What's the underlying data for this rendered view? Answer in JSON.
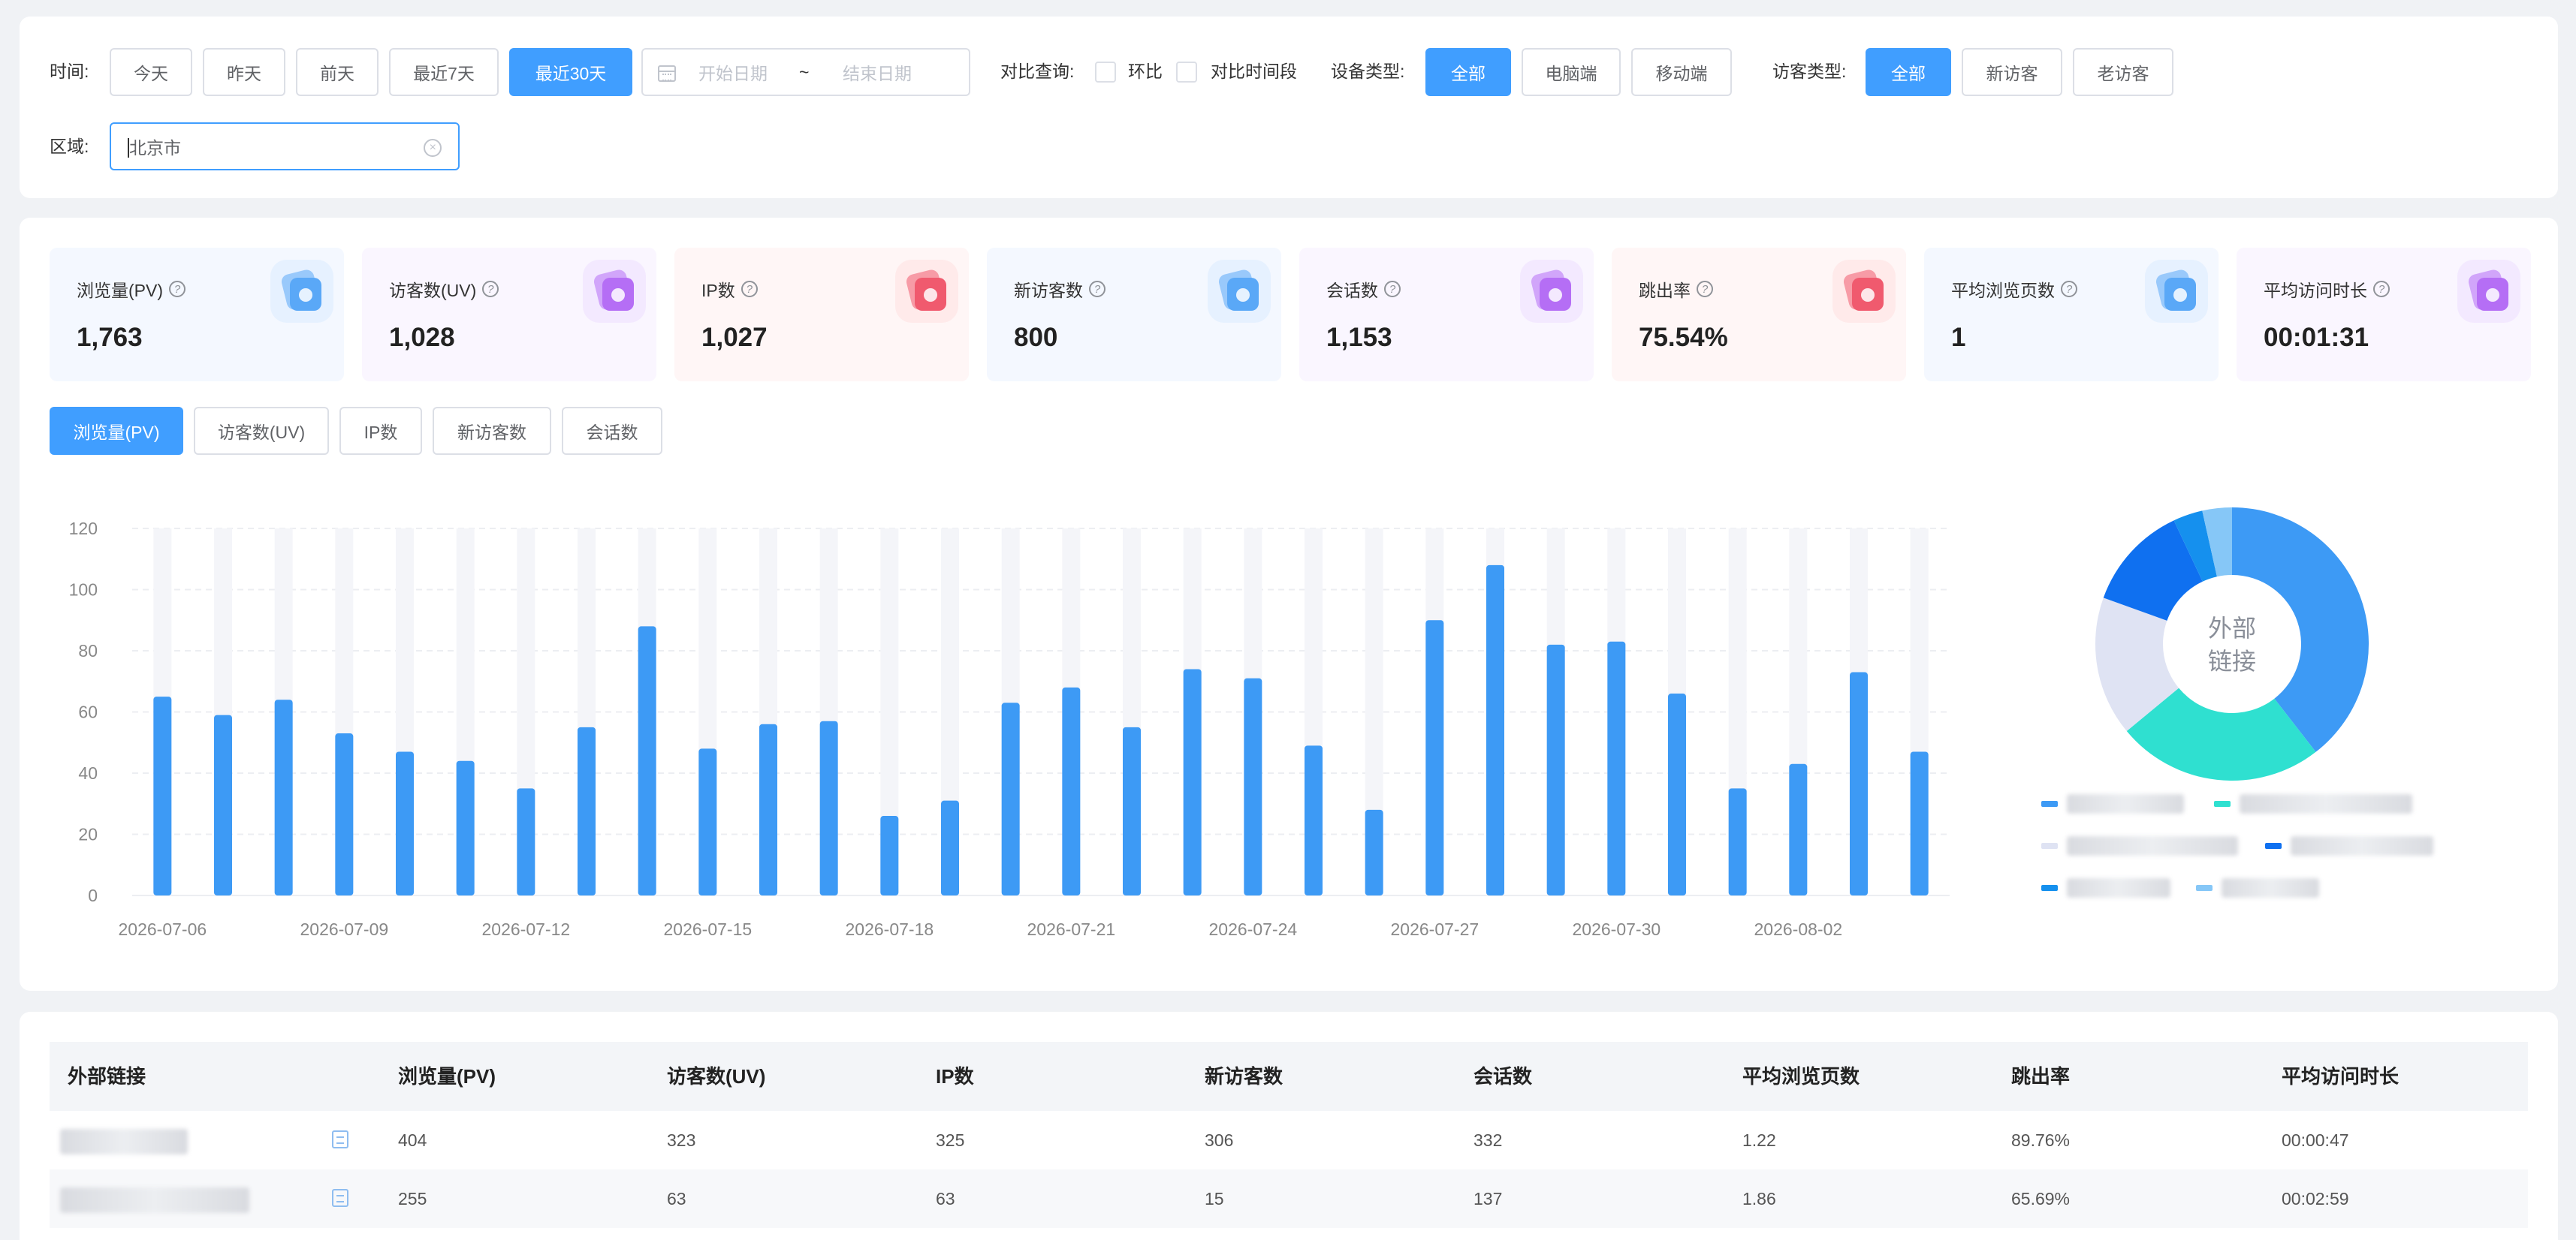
{
  "filters": {
    "time_label": "时间:",
    "time_buttons": [
      "今天",
      "昨天",
      "前天",
      "最近7天",
      "最近30天"
    ],
    "date_start_placeholder": "开始日期",
    "date_sep": "~",
    "date_end_placeholder": "结束日期",
    "compare_label": "对比查询:",
    "compare_options": [
      "环比",
      "对比时间段"
    ],
    "device_label": "设备类型:",
    "device_buttons": [
      "全部",
      "电脑端",
      "移动端"
    ],
    "visitor_label": "访客类型:",
    "visitor_buttons": [
      "全部",
      "新访客",
      "老访客"
    ],
    "region_label": "区域:",
    "region_value": "北京市"
  },
  "kpis": [
    {
      "name": "浏览量(PV)",
      "value": "1,763",
      "icon": "pv-icon",
      "bg": "#f4f8ff",
      "color": "#5aa8f7"
    },
    {
      "name": "访客数(UV)",
      "value": "1,028",
      "icon": "uv-icon",
      "bg": "#faf6ff",
      "color": "#b56ef5"
    },
    {
      "name": "IP数",
      "value": "1,027",
      "icon": "ip-icon",
      "bg": "#fff6f6",
      "color": "#f05a6e"
    },
    {
      "name": "新访客数",
      "value": "800",
      "icon": "new-visitor-icon",
      "bg": "#f4f8ff",
      "color": "#5aa8f7"
    },
    {
      "name": "会话数",
      "value": "1,153",
      "icon": "session-icon",
      "bg": "#faf6ff",
      "color": "#b56ef5"
    },
    {
      "name": "跳出率",
      "value": "75.54%",
      "icon": "bounce-icon",
      "bg": "#fff6f6",
      "color": "#f05a6e"
    },
    {
      "name": "平均浏览页数",
      "value": "1",
      "icon": "avg-pages-icon",
      "bg": "#f4f8ff",
      "color": "#5aa8f7"
    },
    {
      "name": "平均访问时长",
      "value": "00:01:31",
      "icon": "avg-duration-icon",
      "bg": "#faf6ff",
      "color": "#b56ef5"
    }
  ],
  "metric_tabs": [
    "浏览量(PV)",
    "访客数(UV)",
    "IP数",
    "新访客数",
    "会话数"
  ],
  "chart_data": [
    {
      "type": "bar",
      "categories": [
        "2026-07-06",
        "2026-07-07",
        "2026-07-08",
        "2026-07-09",
        "2026-07-10",
        "2026-07-11",
        "2026-07-12",
        "2026-07-13",
        "2026-07-14",
        "2026-07-15",
        "2026-07-16",
        "2026-07-17",
        "2026-07-18",
        "2026-07-19",
        "2026-07-20",
        "2026-07-21",
        "2026-07-22",
        "2026-07-23",
        "2026-07-24",
        "2026-07-25",
        "2026-07-26",
        "2026-07-27",
        "2026-07-28",
        "2026-07-29",
        "2026-07-30",
        "2026-07-31",
        "2026-08-01",
        "2026-08-02",
        "2026-08-03",
        "2026-08-04"
      ],
      "values": [
        65,
        59,
        64,
        53,
        47,
        44,
        35,
        55,
        88,
        48,
        56,
        57,
        26,
        31,
        63,
        68,
        55,
        74,
        71,
        49,
        28,
        90,
        108,
        82,
        83,
        66,
        35,
        43,
        73,
        47
      ],
      "x_tick_labels": [
        "2026-07-06",
        "2026-07-09",
        "2026-07-12",
        "2026-07-15",
        "2026-07-18",
        "2026-07-21",
        "2026-07-24",
        "2026-07-27",
        "2026-07-30",
        "2026-08-02"
      ],
      "y_ticks": [
        0,
        20,
        40,
        60,
        80,
        100,
        120
      ],
      "ylim": [
        0,
        120
      ],
      "grid": true,
      "color": "#3d9af5",
      "background_bar_color": "#f4f5f9"
    },
    {
      "type": "pie",
      "center_label": "外部链接",
      "slices": [
        {
          "value": 39.5,
          "color": "#3d9af5"
        },
        {
          "value": 24.5,
          "color": "#2fe0d0"
        },
        {
          "value": 16.5,
          "color": "#dfe3f3"
        },
        {
          "value": 12.5,
          "color": "#0f70f0"
        },
        {
          "value": 3.5,
          "color": "#1590ee"
        },
        {
          "value": 3.5,
          "color": "#86c7f7"
        }
      ]
    }
  ],
  "table": {
    "headers": [
      "外部链接",
      "浏览量(PV)",
      "访客数(UV)",
      "IP数",
      "新访客数",
      "会话数",
      "平均浏览页数",
      "跳出率",
      "平均访问时长"
    ],
    "rows": [
      [
        "404",
        "323",
        "325",
        "306",
        "332",
        "1.22",
        "89.76%",
        "00:00:47"
      ],
      [
        "255",
        "63",
        "63",
        "15",
        "137",
        "1.86",
        "65.69%",
        "00:02:59"
      ]
    ]
  }
}
